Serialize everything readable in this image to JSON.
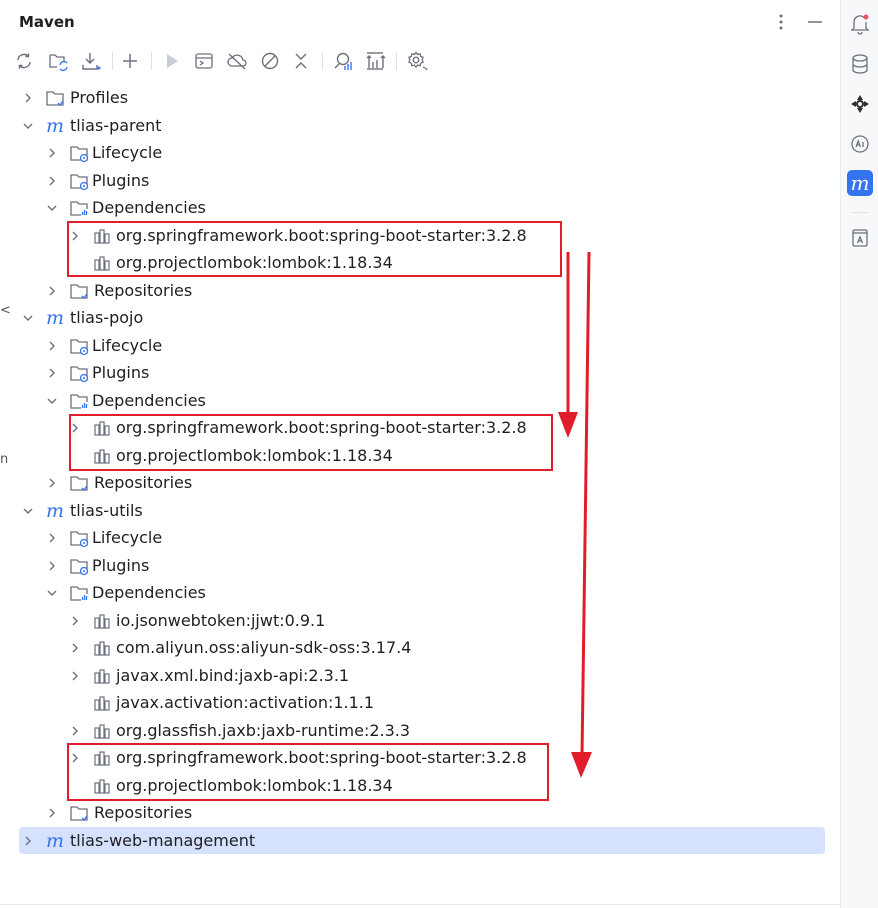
{
  "panel": {
    "title": "Maven"
  },
  "toolbar": {
    "buttons": [
      "reload-all-icon",
      "reload-project-icon",
      "download-icon",
      "add-icon",
      "run-icon",
      "execute-goal-icon",
      "offline-mode-icon",
      "skip-tests-icon",
      "collapse-all-icon",
      "analyze-dependencies-icon",
      "show-dependencies-icon",
      "settings-icon"
    ]
  },
  "tree": {
    "profiles": "Profiles",
    "modules": [
      {
        "name": "tlias-parent",
        "lifecycle": "Lifecycle",
        "plugins": "Plugins",
        "dependencies": "Dependencies",
        "deps": [
          "org.springframework.boot:spring-boot-starter:3.2.8",
          "org.projectlombok:lombok:1.18.34"
        ],
        "repositories": "Repositories"
      },
      {
        "name": "tlias-pojo",
        "lifecycle": "Lifecycle",
        "plugins": "Plugins",
        "dependencies": "Dependencies",
        "deps": [
          "org.springframework.boot:spring-boot-starter:3.2.8",
          "org.projectlombok:lombok:1.18.34"
        ],
        "repositories": "Repositories"
      },
      {
        "name": "tlias-utils",
        "lifecycle": "Lifecycle",
        "plugins": "Plugins",
        "dependencies": "Dependencies",
        "deps": [
          "io.jsonwebtoken:jjwt:0.9.1",
          "com.aliyun.oss:aliyun-sdk-oss:3.17.4",
          "javax.xml.bind:jaxb-api:2.3.1",
          "javax.activation:activation:1.1.1",
          "org.glassfish.jaxb:jaxb-runtime:2.3.3",
          "org.springframework.boot:spring-boot-starter:3.2.8",
          "org.projectlombok:lombok:1.18.34"
        ],
        "repositories": "Repositories"
      },
      {
        "name": "tlias-web-management"
      }
    ]
  },
  "rightbar": {
    "buttons": [
      "notifications-icon",
      "database-icon",
      "ai-spiral-icon",
      "ai-assistant-icon",
      "maven-icon",
      "translate-icon"
    ]
  },
  "colors": {
    "accent": "#3574f0",
    "selected_row": "#d5e1fd",
    "annotation_red": "#e21d2b"
  }
}
